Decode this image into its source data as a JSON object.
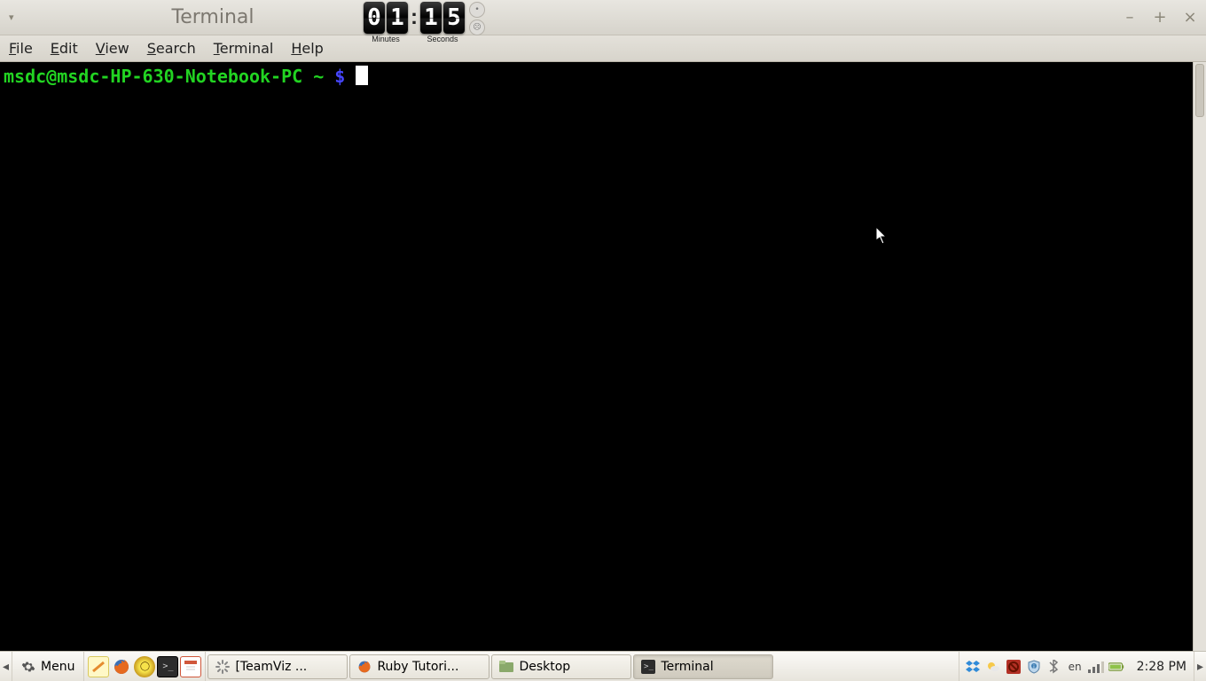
{
  "window": {
    "title": "Terminal",
    "controls": {
      "min": "–",
      "max": "+",
      "close": "×"
    }
  },
  "timer": {
    "minutes": "01",
    "seconds": "15",
    "labels": {
      "minutes": "Minutes",
      "seconds": "Seconds"
    }
  },
  "menubar": [
    "File",
    "Edit",
    "View",
    "Search",
    "Terminal",
    "Help"
  ],
  "prompt": {
    "user_host": "msdc@msdc-HP-630-Notebook-PC",
    "path": "~",
    "symbol": "$"
  },
  "taskbar": {
    "menu_label": "Menu",
    "tasks": [
      {
        "label": "[TeamViz ...",
        "icon": "spinner-icon",
        "active": false
      },
      {
        "label": "Ruby Tutori...",
        "icon": "firefox-icon",
        "active": false
      },
      {
        "label": "Desktop",
        "icon": "folder-icon",
        "active": false
      },
      {
        "label": "Terminal",
        "icon": "terminal-icon",
        "active": true
      }
    ],
    "tray_lang": "en",
    "clock": "2:28 PM"
  },
  "colors": {
    "prompt_user": "#22d422",
    "prompt_dollar": "#4646ff",
    "chrome_top": "#e8e6e0",
    "chrome_bottom": "#d6d3cb"
  }
}
